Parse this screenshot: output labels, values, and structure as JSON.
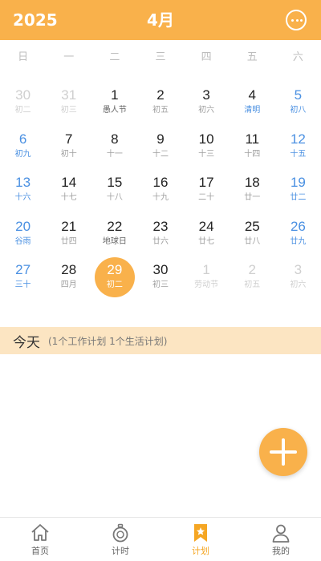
{
  "header": {
    "year": "2025",
    "month": "4月"
  },
  "weekdays": [
    "日",
    "一",
    "二",
    "三",
    "四",
    "五",
    "六"
  ],
  "days": [
    {
      "num": "30",
      "lunar": "初二"
    },
    {
      "num": "31",
      "lunar": "初三"
    },
    {
      "num": "1",
      "lunar": "愚人节"
    },
    {
      "num": "2",
      "lunar": "初五"
    },
    {
      "num": "3",
      "lunar": "初六"
    },
    {
      "num": "4",
      "lunar": "清明"
    },
    {
      "num": "5",
      "lunar": "初八"
    },
    {
      "num": "6",
      "lunar": "初九"
    },
    {
      "num": "7",
      "lunar": "初十"
    },
    {
      "num": "8",
      "lunar": "十一"
    },
    {
      "num": "9",
      "lunar": "十二"
    },
    {
      "num": "10",
      "lunar": "十三"
    },
    {
      "num": "11",
      "lunar": "十四"
    },
    {
      "num": "12",
      "lunar": "十五"
    },
    {
      "num": "13",
      "lunar": "十六"
    },
    {
      "num": "14",
      "lunar": "十七"
    },
    {
      "num": "15",
      "lunar": "十八"
    },
    {
      "num": "16",
      "lunar": "十九"
    },
    {
      "num": "17",
      "lunar": "二十"
    },
    {
      "num": "18",
      "lunar": "廿一"
    },
    {
      "num": "19",
      "lunar": "廿二"
    },
    {
      "num": "20",
      "lunar": "谷雨"
    },
    {
      "num": "21",
      "lunar": "廿四"
    },
    {
      "num": "22",
      "lunar": "地球日"
    },
    {
      "num": "23",
      "lunar": "廿六"
    },
    {
      "num": "24",
      "lunar": "廿七"
    },
    {
      "num": "25",
      "lunar": "廿八"
    },
    {
      "num": "26",
      "lunar": "廿九"
    },
    {
      "num": "27",
      "lunar": "三十"
    },
    {
      "num": "28",
      "lunar": "四月"
    },
    {
      "num": "29",
      "lunar": "初二"
    },
    {
      "num": "30",
      "lunar": "初三"
    },
    {
      "num": "1",
      "lunar": "劳动节"
    },
    {
      "num": "2",
      "lunar": "初五"
    },
    {
      "num": "3",
      "lunar": "初六"
    }
  ],
  "today": {
    "label": "今天",
    "plans": "(1个工作计划  1个生活计划)"
  },
  "tabs": [
    {
      "label": "首页"
    },
    {
      "label": "计时"
    },
    {
      "label": "计划"
    },
    {
      "label": "我的"
    }
  ],
  "colors": {
    "accent": "#F9B14B",
    "weekend": "#4A90E2",
    "today_bar": "#FCE5C2"
  }
}
